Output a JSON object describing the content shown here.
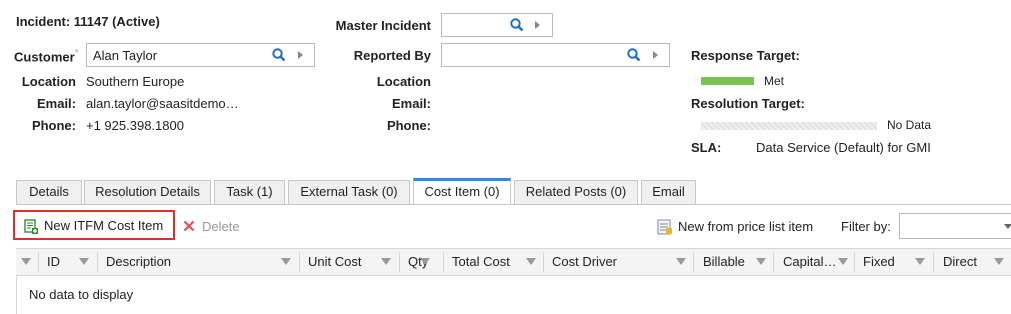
{
  "incident": {
    "title": "Incident: 11147 (Active)"
  },
  "master_incident": {
    "label": "Master Incident",
    "value": ""
  },
  "customer": {
    "label": "Customer",
    "required_mark": "*",
    "value": "Alan Taylor",
    "location_label": "Location",
    "location": "Southern Europe",
    "email_label": "Email:",
    "email": "alan.taylor@saasitdemo…",
    "phone_label": "Phone:",
    "phone": "+1 925.398.1800"
  },
  "reported_by": {
    "label": "Reported By",
    "value": "",
    "location_label": "Location",
    "email_label": "Email:",
    "phone_label": "Phone:"
  },
  "targets": {
    "response_label": "Response Target:",
    "response_status": "Met",
    "response_color": "#7dc353",
    "resolution_label": "Resolution Target:",
    "resolution_status": "No Data",
    "sla_label": "SLA:",
    "sla_value": "Data Service (Default) for GMI"
  },
  "tabs": [
    {
      "label": "Details"
    },
    {
      "label": "Resolution Details"
    },
    {
      "label": "Task (1)"
    },
    {
      "label": "External Task (0)"
    },
    {
      "label": "Cost Item (0)"
    },
    {
      "label": "Related Posts (0)"
    },
    {
      "label": "Email"
    }
  ],
  "active_tab": "Cost Item (0)",
  "toolbar": {
    "new_label": "New ITFM Cost Item",
    "delete_label": "Delete",
    "price_list_label": "New from price list item",
    "filter_label": "Filter by:",
    "filter_value": ""
  },
  "grid": {
    "columns": [
      "ID",
      "Description",
      "Unit Cost",
      "Qty",
      "Total Cost",
      "Cost Driver",
      "Billable",
      "Capital…",
      "Fixed",
      "Direct"
    ],
    "empty_text": "No data to display"
  },
  "colors": {
    "accent": "#2a8fd6",
    "highlight_border": "#d9342b",
    "delete_icon": "#e05050"
  }
}
